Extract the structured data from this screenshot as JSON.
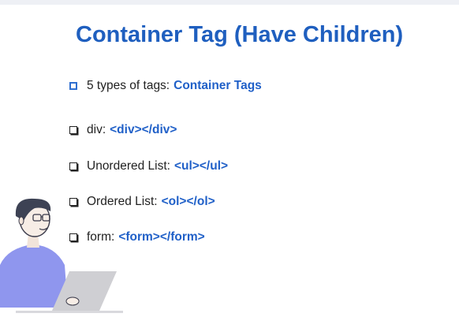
{
  "slide": {
    "title": "Container Tag (Have Children)",
    "intro": {
      "text": "5 types of tags:",
      "highlight": "Container Tags"
    },
    "items": [
      {
        "label": "div:",
        "code": "<div></div>"
      },
      {
        "label": "Unordered List:",
        "code": "<ul></ul>"
      },
      {
        "label": "Ordered List:",
        "code": "<ol></ol>"
      },
      {
        "label": "form:",
        "code": "<form></form>"
      }
    ]
  },
  "colors": {
    "title": "#1f5fbf",
    "code": "#2060c8",
    "illustration": "#8f96ee"
  },
  "icons": {
    "intro_bullet": "hollow-square-blue",
    "item_bullet": "shadowed-square-black",
    "illustration": "person-at-laptop"
  }
}
